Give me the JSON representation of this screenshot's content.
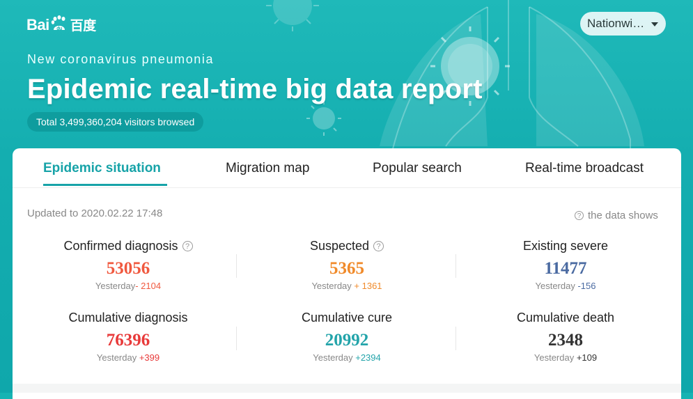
{
  "header": {
    "logo": {
      "latin": "Bai",
      "latin2": "du",
      "cn": "百度"
    },
    "region_button": "Nationwi…",
    "subtitle": "New coronavirus pneumonia",
    "title": "Epidemic real-time big data report",
    "visitors": "Total 3,499,360,204 visitors browsed"
  },
  "tabs": [
    {
      "label": "Epidemic situation",
      "active": true
    },
    {
      "label": "Migration map"
    },
    {
      "label": "Popular search"
    },
    {
      "label": "Real-time broadcast"
    }
  ],
  "summary": {
    "updated": "Updated to 2020.02.22 17:48",
    "data_shows": "the data shows"
  },
  "stats": [
    {
      "label": "Confirmed diagnosis",
      "value": "53056",
      "yest_prefix": "Yesterday",
      "delta": "- 2104",
      "color": "#f0593f"
    },
    {
      "label": "Suspected",
      "value": "5365",
      "yest_prefix": "Yesterday",
      "delta": " + 1361",
      "color": "#f08a2a"
    },
    {
      "label": "Existing severe",
      "value": "11477",
      "yest_prefix": "Yesterday",
      "delta": " -156",
      "color": "#4a6aa1"
    },
    {
      "label": "Cumulative diagnosis",
      "value": "76396",
      "yest_prefix": "Yesterday",
      "delta": " +399",
      "color": "#e83a3a"
    },
    {
      "label": "Cumulative cure",
      "value": "20992",
      "yest_prefix": "Yesterday",
      "delta": " +2394",
      "color": "#23a4aa"
    },
    {
      "label": "Cumulative death",
      "value": "2348",
      "yest_prefix": "Yesterday",
      "delta": " +109",
      "color": "#333333"
    }
  ],
  "colors": {
    "accent": "#17a3a8",
    "hero_bg": "#16b3b3"
  }
}
